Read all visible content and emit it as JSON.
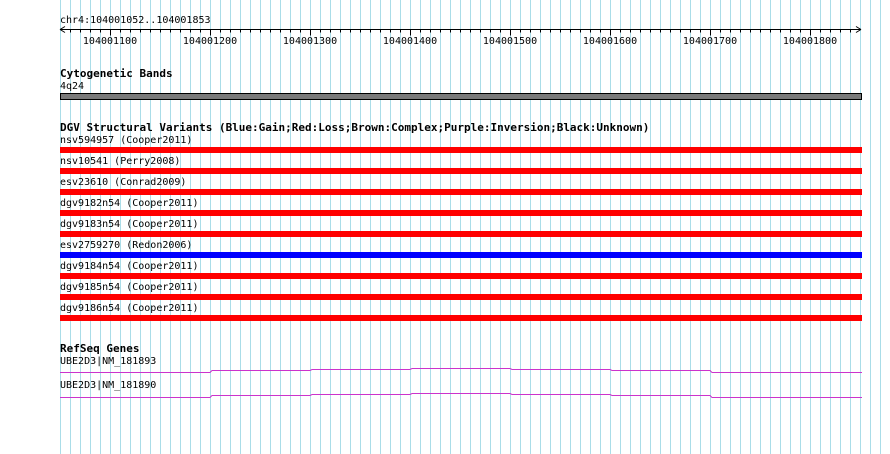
{
  "ruler": {
    "coord_label": "chr4:104001052..104001853",
    "ticks": [
      "104001100",
      "104001200",
      "104001300",
      "104001400",
      "104001500",
      "104001600",
      "104001700",
      "104001800"
    ]
  },
  "cytoband": {
    "header": "Cytogenetic Bands",
    "band_label": "4q24",
    "color": "#7a7a7a"
  },
  "dgv": {
    "header": "DGV Structural Variants (Blue:Gain;Red:Loss;Brown:Complex;Purple:Inversion;Black:Unknown)",
    "colors": {
      "loss": "#ff0000",
      "gain": "#0000ff"
    },
    "features": [
      {
        "label": "nsv594957 (Cooper2011)",
        "type": "loss"
      },
      {
        "label": "nsv10541 (Perry2008)",
        "type": "loss"
      },
      {
        "label": "esv23610 (Conrad2009)",
        "type": "loss"
      },
      {
        "label": "dgv9182n54 (Cooper2011)",
        "type": "loss"
      },
      {
        "label": "dgv9183n54 (Cooper2011)",
        "type": "loss"
      },
      {
        "label": "esv2759270 (Redon2006)",
        "type": "gain"
      },
      {
        "label": "dgv9184n54 (Cooper2011)",
        "type": "loss"
      },
      {
        "label": "dgv9185n54 (Cooper2011)",
        "type": "loss"
      },
      {
        "label": "dgv9186n54 (Cooper2011)",
        "type": "loss"
      }
    ]
  },
  "refseq": {
    "header": "RefSeq Genes",
    "color": "#cc33cc",
    "transcripts": [
      {
        "label": "UBE2D3|NM_181893"
      },
      {
        "label": "UBE2D3|NM_181890"
      }
    ]
  },
  "grid_color": "#aadde8"
}
